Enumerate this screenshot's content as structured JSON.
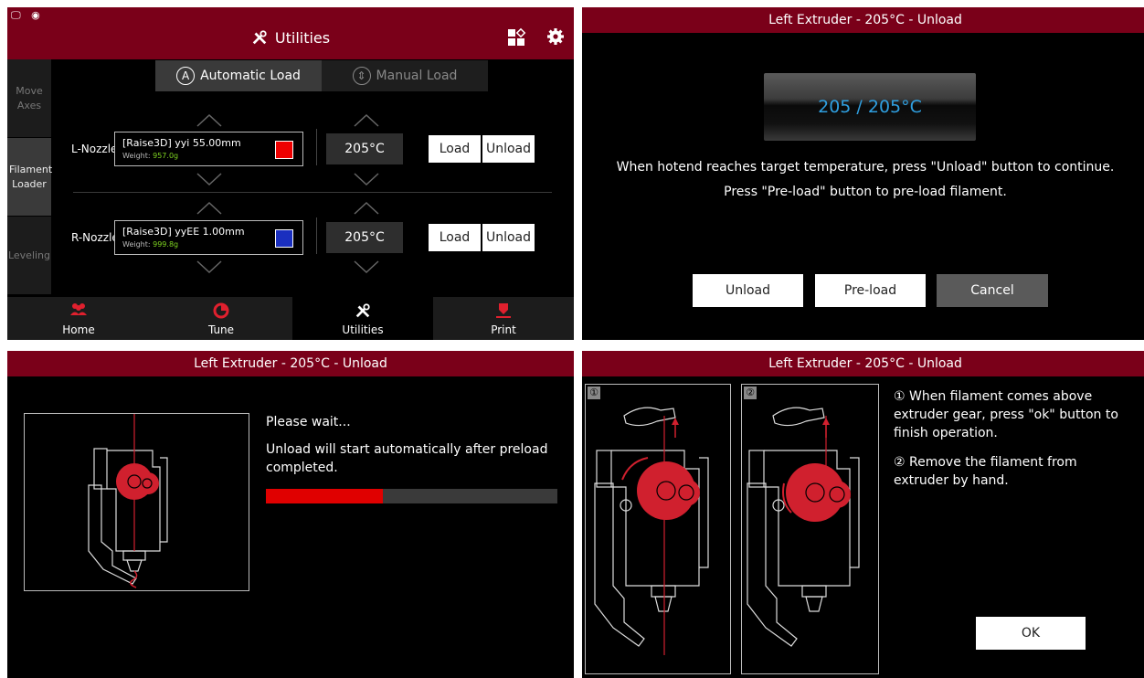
{
  "panel1": {
    "title": "Utilities",
    "sidebar": [
      {
        "label": "Move Axes",
        "active": false
      },
      {
        "label": "Filament Loader",
        "active": true
      },
      {
        "label": "Leveling",
        "active": false
      }
    ],
    "mode_tabs": {
      "automatic": {
        "icon": "A",
        "label": "Automatic Load"
      },
      "manual": {
        "icon": "⇕",
        "label": "Manual Load"
      }
    },
    "left": {
      "nozzle": "L-Nozzle",
      "filament_name": "[Raise3D] yyi 55.00mm",
      "weight_label": "Weight:",
      "weight_value": "957.0g",
      "swatch_color": "#ee0000",
      "temperature": "205°C",
      "load": "Load",
      "unload": "Unload"
    },
    "right": {
      "nozzle": "R-Nozzle",
      "filament_name": "[Raise3D] yyEE 1.00mm",
      "weight_label": "Weight:",
      "weight_value": "999.8g",
      "swatch_color": "#1a2fbf",
      "temperature": "205°C",
      "load": "Load",
      "unload": "Unload"
    },
    "nav": {
      "home": "Home",
      "tune": "Tune",
      "utilities": "Utilities",
      "print": "Print"
    }
  },
  "panel2": {
    "title": "Left Extruder - 205°C - Unload",
    "temp_display": "205 / 205°C",
    "line1": "When hotend reaches target temperature, press \"Unload\" button to continue.",
    "line2": "Press \"Pre-load\" button to pre-load filament.",
    "unload": "Unload",
    "preload": "Pre-load",
    "cancel": "Cancel"
  },
  "panel3": {
    "title": "Left Extruder - 205°C - Unload",
    "wait": "Please wait...",
    "info_line1": "Unload will start automatically after preload",
    "info_line2": "completed.",
    "progress_fraction": 0.4
  },
  "panel4": {
    "title": "Left Extruder - 205°C - Unload",
    "step1_num": "①",
    "step2_num": "②",
    "step1_l1": "① When filament comes above",
    "step1_l2": "extruder gear, press \"ok\" button to",
    "step1_l3": "finish operation.",
    "step2_l1": "② Remove the filament from",
    "step2_l2": "extruder by hand.",
    "ok": "OK"
  },
  "colors": {
    "header": "#7a0019",
    "accent_red": "#e0202e",
    "temp_blue": "#2f9fe0",
    "weight_green": "#7ed321"
  }
}
